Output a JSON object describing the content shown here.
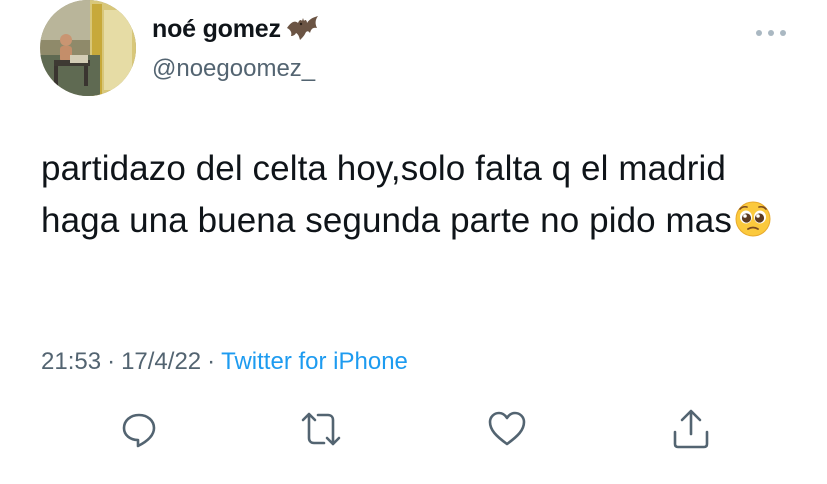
{
  "author": {
    "display_name": "noé gomez",
    "name_emoji": "bat-emoji",
    "handle": "@noegoomez_",
    "avatar": "profile-avatar"
  },
  "tweet": {
    "text": "partidazo del celta hoy,solo falta q el madrid haga una buena segunda parte no pido mas",
    "trailing_emoji": "pleading-face-emoji",
    "time": "21:53",
    "date": "17/4/22",
    "separator": "·",
    "source": "Twitter for iPhone"
  },
  "actions": [
    {
      "name": "reply",
      "icon": "reply-icon"
    },
    {
      "name": "retweet",
      "icon": "retweet-icon"
    },
    {
      "name": "like",
      "icon": "heart-icon"
    },
    {
      "name": "share",
      "icon": "share-icon"
    }
  ],
  "menu_icon": "more-options-icon",
  "colors": {
    "text": "#0f1419",
    "secondary": "#536471",
    "link": "#1d9bf0",
    "icon": "#536471"
  }
}
